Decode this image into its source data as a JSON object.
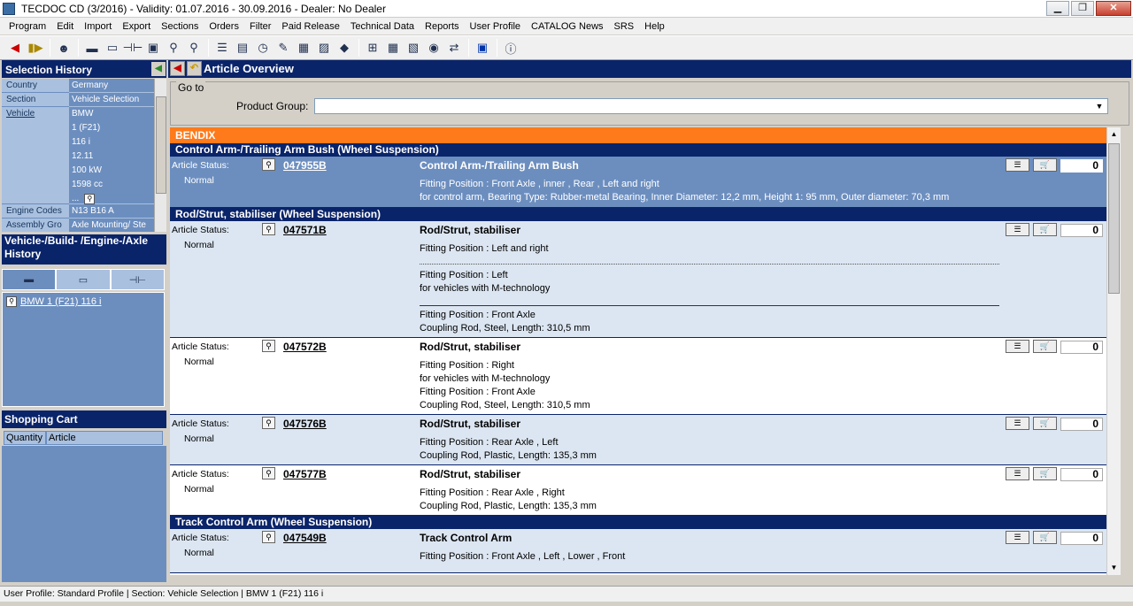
{
  "window": {
    "title": "TECDOC CD (3/2016)   - Validity: 01.07.2016 - 30.09.2016 - Dealer: No Dealer"
  },
  "menu": [
    "Program",
    "Edit",
    "Import",
    "Export",
    "Sections",
    "Orders",
    "Filter",
    "Paid Release",
    "Technical Data",
    "Reports",
    "User Profile",
    "CATALOG News",
    "SRS",
    "Help"
  ],
  "selection_history": {
    "title": "Selection History",
    "rows": [
      {
        "k": "Country",
        "v": "Germany"
      },
      {
        "k": "Section",
        "v": "Vehicle Selection"
      }
    ],
    "vehicle": {
      "k": "Vehicle",
      "lines": [
        "BMW",
        "1 (F21)",
        "116 i",
        "12.11",
        "100 kW",
        "1598 cc",
        "..."
      ]
    },
    "engine": {
      "k": "Engine Codes",
      "v": "N13 B16 A"
    },
    "assembly": {
      "k": "Assembly Gro",
      "v": "Axle Mounting/ Ste"
    }
  },
  "vbh": {
    "title": "Vehicle-/Build- /Engine-/Axle History",
    "items": [
      "BMW 1 (F21) 116 i"
    ]
  },
  "cart": {
    "title": "Shopping Cart",
    "col1": "Quantity",
    "col2": "Article"
  },
  "main": {
    "title": "Article Overview",
    "goto_label": "Go to",
    "product_group_label": "Product Group:",
    "product_group_value": "",
    "brand": "BENDIX",
    "status_label": "Article Status:",
    "status_value": "Normal",
    "groups": [
      {
        "name": "Control Arm-/Trailing Arm Bush (Wheel Suspension)",
        "articles": [
          {
            "num": "047955B",
            "name": "Control Arm-/Trailing Arm Bush",
            "qty": "0",
            "lines": [
              "Fitting Position : Front Axle , inner , Rear , Left and right",
              "for control arm, Bearing Type: Rubber-metal Bearing, Inner Diameter: 12,2 mm, Height 1: 95 mm, Outer diameter: 70,3 mm"
            ]
          }
        ]
      },
      {
        "name": "Rod/Strut, stabiliser (Wheel Suspension)",
        "articles": [
          {
            "num": "047571B",
            "name": "Rod/Strut, stabiliser",
            "qty": "0",
            "lines": [
              "Fitting Position : Left and right",
              "Fitting Position : Left",
              "for vehicles with M-technology",
              "Fitting Position : Front Axle",
              "Coupling Rod, Steel, Length: 310,5 mm"
            ]
          },
          {
            "num": "047572B",
            "name": "Rod/Strut, stabiliser",
            "qty": "0",
            "lines": [
              "Fitting Position : Right",
              "for vehicles with M-technology",
              "Fitting Position : Front Axle",
              "Coupling Rod, Steel, Length: 310,5 mm"
            ]
          },
          {
            "num": "047576B",
            "name": "Rod/Strut, stabiliser",
            "qty": "0",
            "lines": [
              "Fitting Position : Rear Axle , Left",
              "Coupling Rod, Plastic, Length: 135,3 mm"
            ]
          },
          {
            "num": "047577B",
            "name": "Rod/Strut, stabiliser",
            "qty": "0",
            "lines": [
              "Fitting Position : Rear Axle , Right",
              "Coupling Rod, Plastic, Length: 135,3 mm"
            ]
          }
        ]
      },
      {
        "name": "Track Control Arm (Wheel Suspension)",
        "articles": [
          {
            "num": "047549B",
            "name": "Track Control Arm",
            "qty": "0",
            "lines": [
              "Fitting Position : Front Axle , Left , Lower , Front"
            ]
          }
        ]
      }
    ]
  },
  "status_bar": "User Profile: Standard Profile | Section: Vehicle Selection | BMW 1 (F21) 116 i"
}
